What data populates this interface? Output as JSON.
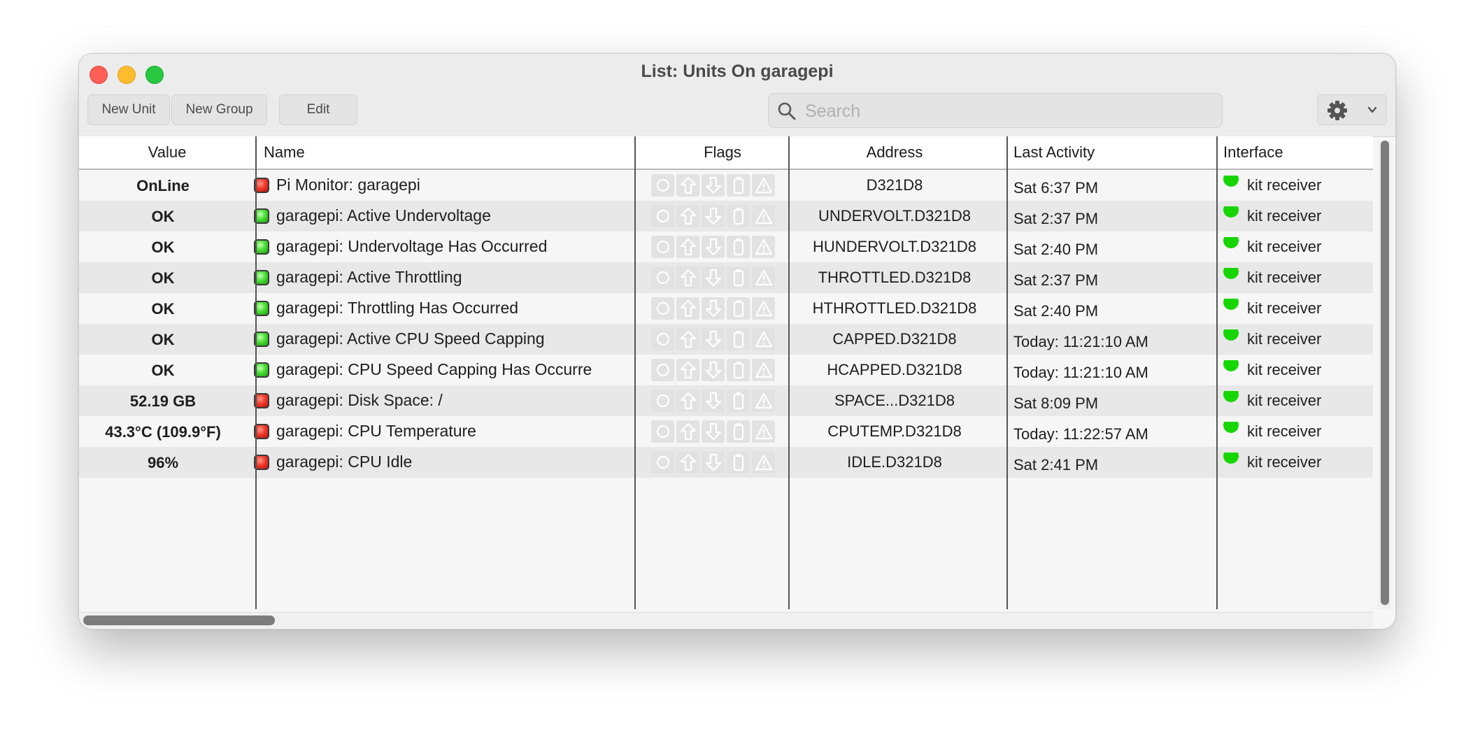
{
  "window": {
    "title": "List: Units On garagepi"
  },
  "toolbar": {
    "new_unit": "New Unit",
    "new_group": "New Group",
    "edit": "Edit",
    "search_placeholder": "Search"
  },
  "columns": {
    "value": "Value",
    "name": "Name",
    "flags": "Flags",
    "address": "Address",
    "last_activity": "Last Activity",
    "interface": "Interface"
  },
  "rows": [
    {
      "value": "OnLine",
      "name": "Pi Monitor: garagepi",
      "status": "red",
      "address": "D321D8",
      "last_activity": "Sat 6:37 PM",
      "interface": "kit receiver"
    },
    {
      "value": "OK",
      "name": "garagepi: Active Undervoltage",
      "status": "green",
      "address": "UNDERVOLT.D321D8",
      "last_activity": "Sat 2:37 PM",
      "interface": "kit receiver"
    },
    {
      "value": "OK",
      "name": "garagepi: Undervoltage Has Occurred",
      "status": "green",
      "address": "HUNDERVOLT.D321D8",
      "last_activity": "Sat 2:40 PM",
      "interface": "kit receiver"
    },
    {
      "value": "OK",
      "name": "garagepi: Active Throttling",
      "status": "green",
      "address": "THROTTLED.D321D8",
      "last_activity": "Sat 2:37 PM",
      "interface": "kit receiver"
    },
    {
      "value": "OK",
      "name": "garagepi: Throttling Has Occurred",
      "status": "green",
      "address": "HTHROTTLED.D321D8",
      "last_activity": "Sat 2:40 PM",
      "interface": "kit receiver"
    },
    {
      "value": "OK",
      "name": "garagepi: Active CPU Speed Capping",
      "status": "green",
      "address": "CAPPED.D321D8",
      "last_activity": "Today: 11:21:10 AM",
      "interface": "kit receiver"
    },
    {
      "value": "OK",
      "name": "garagepi: CPU Speed Capping Has Occurre",
      "status": "green",
      "address": "HCAPPED.D321D8",
      "last_activity": "Today: 11:21:10 AM",
      "interface": "kit receiver"
    },
    {
      "value": "52.19 GB",
      "name": "garagepi: Disk Space: /",
      "status": "red",
      "address": "SPACE...D321D8",
      "last_activity": "Sat 8:09 PM",
      "interface": "kit receiver"
    },
    {
      "value": "43.3°C (109.9°F)",
      "name": "garagepi: CPU Temperature",
      "status": "red",
      "address": "CPUTEMP.D321D8",
      "last_activity": "Today: 11:22:57 AM",
      "interface": "kit receiver"
    },
    {
      "value": "96%",
      "name": "garagepi: CPU Idle",
      "status": "red",
      "address": "IDLE.D321D8",
      "last_activity": "Sat 2:41 PM",
      "interface": "kit receiver"
    }
  ],
  "flag_icons": [
    "circle-icon",
    "arrow-up-icon",
    "arrow-down-icon",
    "battery-icon",
    "warning-icon"
  ],
  "colors": {
    "status_red": "#f13a2b",
    "status_green": "#49e034",
    "interface_dot": "#17d600"
  }
}
